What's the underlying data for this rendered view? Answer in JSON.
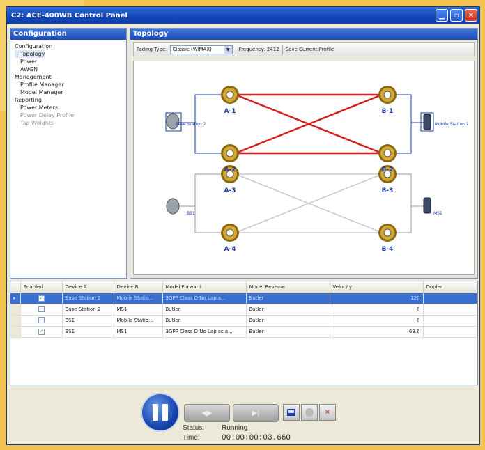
{
  "window": {
    "title": "C2: ACE-400WB Control Panel"
  },
  "config": {
    "header": "Configuration",
    "groups": [
      {
        "label": "Configuration",
        "items": [
          {
            "label": "Topology",
            "selected": true,
            "disabled": false
          },
          {
            "label": "Power",
            "selected": false,
            "disabled": false
          },
          {
            "label": "AWGN",
            "selected": false,
            "disabled": false
          }
        ]
      },
      {
        "label": "Management",
        "items": [
          {
            "label": "Profile Manager",
            "selected": false,
            "disabled": false
          },
          {
            "label": "Model Manager",
            "selected": false,
            "disabled": false
          }
        ]
      },
      {
        "label": "Reporting",
        "items": [
          {
            "label": "Power Meters",
            "selected": false,
            "disabled": false
          },
          {
            "label": "Power Delay Profile",
            "selected": false,
            "disabled": true
          },
          {
            "label": "Tap Weights",
            "selected": false,
            "disabled": true
          }
        ]
      }
    ]
  },
  "topology": {
    "header": "Topology",
    "fading_label": "Fading Type:",
    "fading_value": "Classic (WiMAX)",
    "frequency": "Frequency: 2412",
    "save_profile": "Save Current Profile",
    "nodes": {
      "a1": "A-1",
      "a2": "A-2",
      "a3": "A-3",
      "a4": "A-4",
      "b1": "B-1",
      "b2": "B-2",
      "b3": "B-3",
      "b4": "B-4",
      "base_station": "Base Station 2",
      "mobile_station": "Mobile Station 2",
      "bs1": "BS1",
      "ms1": "MS1"
    },
    "colors": {
      "active_link": "#d42020",
      "inactive_link": "#c8c8c8",
      "label": "#1a3aa8"
    }
  },
  "grid": {
    "columns": [
      "Enabled",
      "Device A",
      "Device B",
      "Model Forward",
      "Model Reverse",
      "Velocity",
      "Dopler"
    ],
    "rows": [
      {
        "enabled": true,
        "device_a": "Base Station 2",
        "device_b": "Mobile Statio...",
        "forward": "3GPP Class D No Lapla...",
        "reverse": "Butler",
        "velocity": "120",
        "dopler": "",
        "selected": true
      },
      {
        "enabled": false,
        "device_a": "Base Station 2",
        "device_b": "MS1",
        "forward": "Butler",
        "reverse": "Butler",
        "velocity": "0",
        "dopler": "",
        "selected": false
      },
      {
        "enabled": false,
        "device_a": "BS1",
        "device_b": "Mobile Statio...",
        "forward": "Butler",
        "reverse": "Butler",
        "velocity": "0",
        "dopler": "",
        "selected": false
      },
      {
        "enabled": true,
        "device_a": "BS1",
        "device_b": "MS1",
        "forward": "3GPP Class D No Laplacia...",
        "reverse": "Butler",
        "velocity": "69.6",
        "dopler": "",
        "selected": false
      }
    ]
  },
  "controls": {
    "status_label": "Status:",
    "status_value": "Running",
    "time_label": "Time:",
    "time_value": "00:00:00:03.660"
  }
}
